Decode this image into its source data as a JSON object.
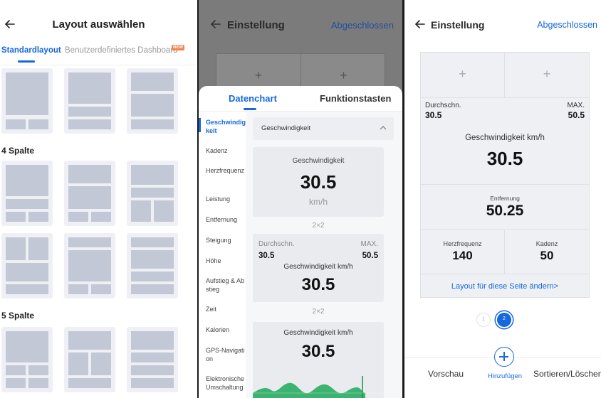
{
  "screen1": {
    "title": "Layout auswählen",
    "tabs": [
      "Standardlayout",
      "Benutzerdefiniertes Dashboard"
    ],
    "new_badge": "NEW",
    "sections": [
      "4 Spalte",
      "5 Spalte"
    ]
  },
  "screen2": {
    "title": "Einstellung",
    "done": "Abgeschlossen",
    "plus": "+",
    "tabs": [
      "Datenchart",
      "Funktionstasten"
    ],
    "sidebar": [
      "Geschwindigkeit",
      "Kadenz",
      "Herzfrequenz",
      "Leistung",
      "Entfernung",
      "Steigung",
      "Höhe",
      "Aufstieg & Abstieg",
      "Zeit",
      "Kalorien",
      "GPS-Navigation",
      "Elektronische Umschaltung"
    ],
    "dropdown": "Geschwindigkeit",
    "card1": {
      "title": "Geschwindigkeit",
      "value": "30.5",
      "unit": "km/h"
    },
    "size1": "2×2",
    "card2": {
      "avg_label": "Durchschn.",
      "avg_value": "30.5",
      "max_label": "MAX.",
      "max_value": "50.5",
      "title": "Geschwindigkeit km/h",
      "value": "30.5"
    },
    "size2": "2×2",
    "card3": {
      "title": "Geschwindigkeit km/h",
      "value": "30.5"
    }
  },
  "screen3": {
    "title": "Einstellung",
    "done": "Abgeschlossen",
    "plus": "+",
    "speed": {
      "avg_label": "Durchschn.",
      "avg_value": "30.5",
      "max_label": "MAX.",
      "max_value": "50.5",
      "title": "Geschwindigkeit km/h",
      "value": "30.5"
    },
    "distance": {
      "label": "Entfernung",
      "value": "50.25"
    },
    "heart": {
      "label": "Herzfrequenz",
      "value": "140"
    },
    "cadence": {
      "label": "Kadenz",
      "value": "50"
    },
    "change_layout": "Layout für diese Seite ändern>",
    "pages": [
      "1",
      "2"
    ],
    "footer": {
      "preview": "Vorschau",
      "add": "Hinzufügen",
      "sort": "Sortieren/Löschen"
    }
  },
  "colors": {
    "accent": "#1668dc",
    "badge": "#f5804e",
    "chart": "#3cb371"
  }
}
